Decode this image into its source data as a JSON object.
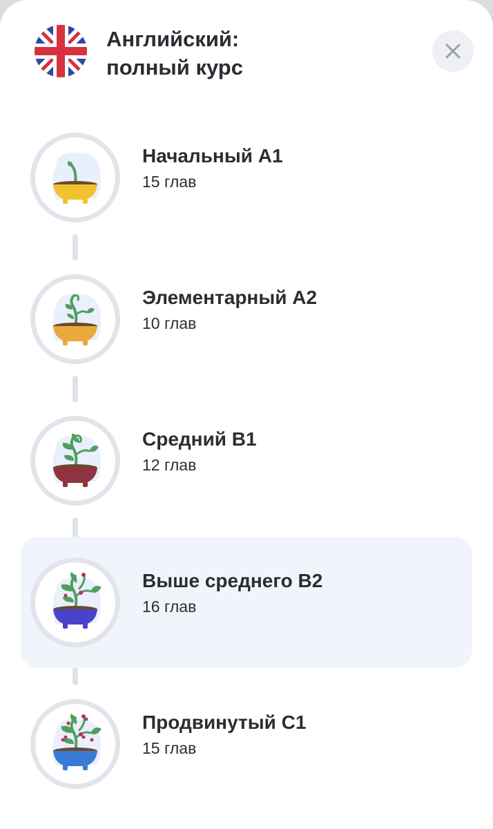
{
  "course": {
    "title_line1": "Английский:",
    "title_line2": "полный курс",
    "flag_icon": "uk-flag-icon"
  },
  "close": {
    "icon": "close-icon"
  },
  "colors": {
    "accent_bg": "#f1f4fa",
    "ring": "#e1e4ea",
    "connector": "#dfe2e8",
    "text": "#2b2d33"
  },
  "levels": [
    {
      "name": "Начальный А1",
      "chapters": "15 глав",
      "icon": "sprout-plant-icon",
      "pot_color": "#f2c12e",
      "active": false
    },
    {
      "name": "Элементарный А2",
      "chapters": "10 глав",
      "icon": "young-plant-icon",
      "pot_color": "#e9a93c",
      "active": false
    },
    {
      "name": "Средний В1",
      "chapters": "12 глав",
      "icon": "growing-plant-icon",
      "pot_color": "#8f3340",
      "active": false
    },
    {
      "name": "Выше среднего В2",
      "chapters": "16 глав",
      "icon": "budding-plant-icon",
      "pot_color": "#4a43c9",
      "active": true
    },
    {
      "name": "Продвинутый С1",
      "chapters": "15 глав",
      "icon": "flowering-plant-icon",
      "pot_color": "#3a7bd8",
      "active": false
    }
  ]
}
